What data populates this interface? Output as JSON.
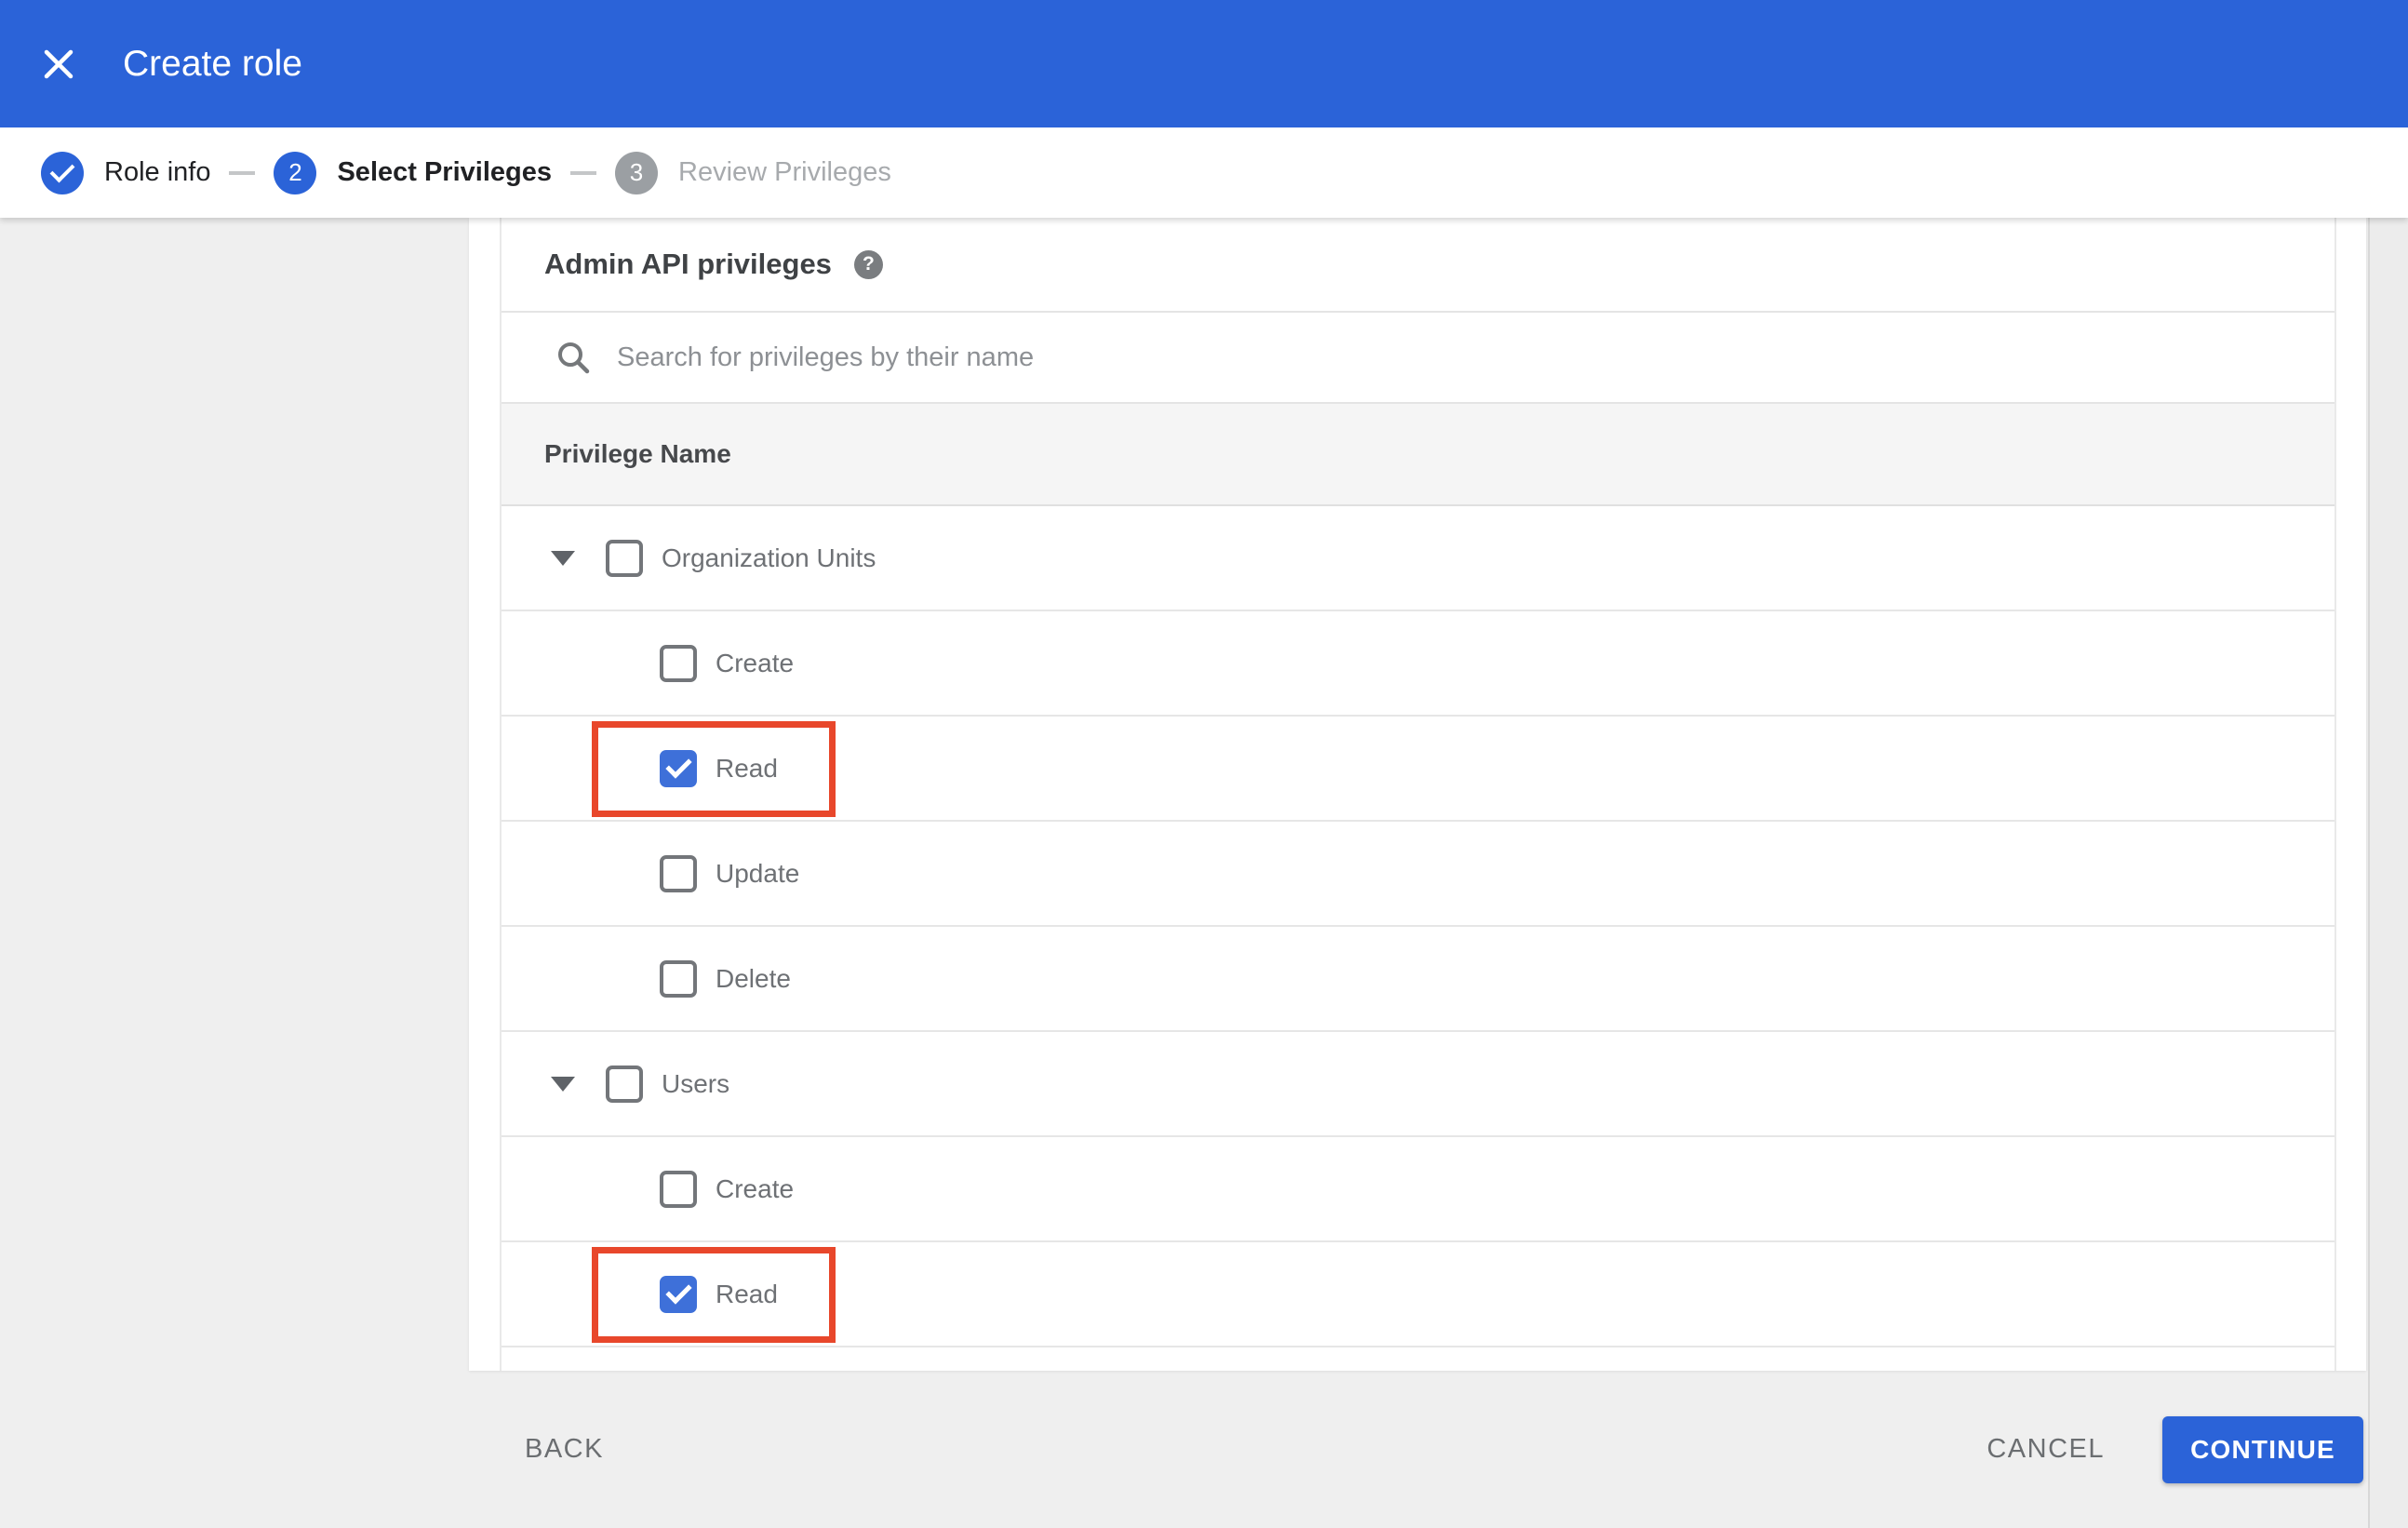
{
  "header": {
    "title": "Create role"
  },
  "stepper": {
    "steps": [
      {
        "label": "Role info",
        "state": "complete",
        "indicator": "check"
      },
      {
        "label": "Select Privileges",
        "state": "active",
        "indicator": "2"
      },
      {
        "label": "Review Privileges",
        "state": "upcoming",
        "indicator": "3"
      }
    ]
  },
  "content": {
    "section_title": "Admin API privileges",
    "help_glyph": "?",
    "search": {
      "placeholder": "Search for privileges by their name",
      "value": ""
    },
    "table": {
      "header": "Privilege Name",
      "groups": [
        {
          "label": "Organization Units",
          "checked": false,
          "expanded": true,
          "children": [
            {
              "label": "Create",
              "checked": false,
              "highlighted": false
            },
            {
              "label": "Read",
              "checked": true,
              "highlighted": true
            },
            {
              "label": "Update",
              "checked": false,
              "highlighted": false
            },
            {
              "label": "Delete",
              "checked": false,
              "highlighted": false
            }
          ]
        },
        {
          "label": "Users",
          "checked": false,
          "expanded": true,
          "children": [
            {
              "label": "Create",
              "checked": false,
              "highlighted": false
            },
            {
              "label": "Read",
              "checked": true,
              "highlighted": true
            }
          ]
        }
      ]
    }
  },
  "footer": {
    "back_label": "BACK",
    "cancel_label": "CANCEL",
    "continue_label": "CONTINUE"
  },
  "colors": {
    "accent_blue": "#2b63d8",
    "checkbox_blue": "#3e70d9",
    "highlight_red": "#e8472b",
    "page_gray": "#efefef",
    "table_header_gray": "#f5f5f5"
  }
}
